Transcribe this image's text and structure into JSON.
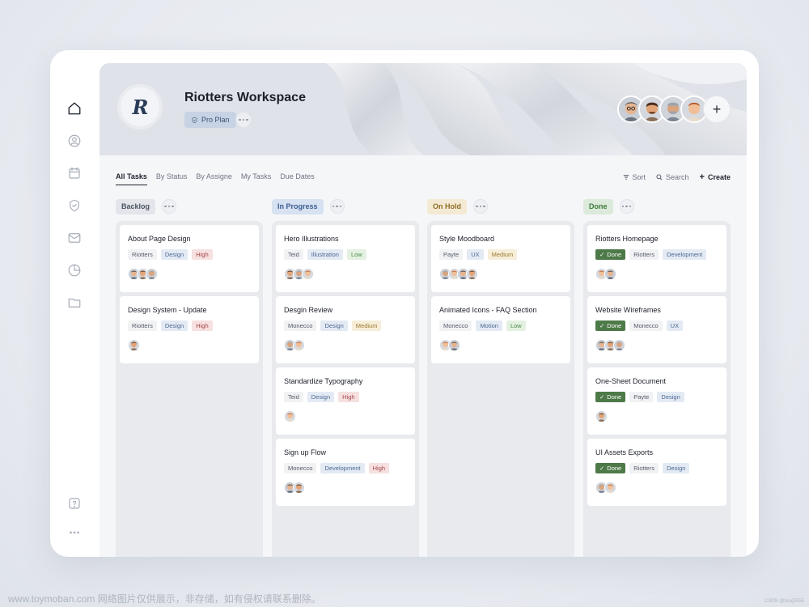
{
  "workspace": {
    "logo_letter": "R",
    "title": "Riotters Workspace",
    "plan": "Pro Plan"
  },
  "sidebar": {
    "items": [
      {
        "icon": "home-icon",
        "active": true
      },
      {
        "icon": "user-circle-icon",
        "active": false
      },
      {
        "icon": "calendar-icon",
        "active": false
      },
      {
        "icon": "shield-icon",
        "active": false
      },
      {
        "icon": "mail-icon",
        "active": false
      },
      {
        "icon": "pie-chart-icon",
        "active": false
      },
      {
        "icon": "folder-icon",
        "active": false
      }
    ],
    "help_icon": "help-icon",
    "more_icon": "more-icon"
  },
  "members": [
    "avatar-1",
    "avatar-2",
    "avatar-3",
    "avatar-4"
  ],
  "add_member_label": "+",
  "tabs": [
    {
      "label": "All Tasks",
      "active": true
    },
    {
      "label": "By Status",
      "active": false
    },
    {
      "label": "By Assigne",
      "active": false
    },
    {
      "label": "My Tasks",
      "active": false
    },
    {
      "label": "Due Dates",
      "active": false
    }
  ],
  "toolbar": {
    "sort": "Sort",
    "search": "Search",
    "create": "Create",
    "create_symbol": "+"
  },
  "columns": [
    {
      "status": "Backlog",
      "pill_bg": "#e3e5ea",
      "pill_color": "#4c525e",
      "cards": [
        {
          "title": "About Page Design",
          "tags": [
            [
              "Riotters",
              "neutral"
            ],
            [
              "Design",
              "blue"
            ],
            [
              "High",
              "red"
            ]
          ],
          "avatars": 3
        },
        {
          "title": "Design System - Update",
          "tags": [
            [
              "Riotters",
              "neutral"
            ],
            [
              "Design",
              "blue"
            ],
            [
              "High",
              "red"
            ]
          ],
          "avatars": 1
        }
      ]
    },
    {
      "status": "In Progress",
      "pill_bg": "#d6e1f1",
      "pill_color": "#3e5e93",
      "cards": [
        {
          "title": "Hero Illustrations",
          "tags": [
            [
              "Teid",
              "neutral"
            ],
            [
              "Illustration",
              "blue"
            ],
            [
              "Low",
              "green"
            ]
          ],
          "avatars": 3
        },
        {
          "title": "Desgin Review",
          "tags": [
            [
              "Monecco",
              "neutral"
            ],
            [
              "Design",
              "blue"
            ],
            [
              "Medium",
              "yellow"
            ]
          ],
          "avatars": 2
        },
        {
          "title": "Standardize Typography",
          "tags": [
            [
              "Teid",
              "neutral"
            ],
            [
              "Design",
              "blue"
            ],
            [
              "High",
              "red"
            ]
          ],
          "avatars": 1
        },
        {
          "title": "Sign up Flow",
          "tags": [
            [
              "Monecco",
              "neutral"
            ],
            [
              "Development",
              "blue"
            ],
            [
              "High",
              "red"
            ]
          ],
          "avatars": 2
        }
      ]
    },
    {
      "status": "On Hold",
      "pill_bg": "#f4ead4",
      "pill_color": "#8d6d24",
      "cards": [
        {
          "title": "Style Moodboard",
          "tags": [
            [
              "Payte",
              "neutral"
            ],
            [
              "UX",
              "blue"
            ],
            [
              "Medium",
              "yellow"
            ]
          ],
          "avatars": 4
        },
        {
          "title": "Animated Icons - FAQ Section",
          "tags": [
            [
              "Monecco",
              "neutral"
            ],
            [
              "Motion",
              "blue"
            ],
            [
              "Low",
              "green"
            ]
          ],
          "avatars": 2
        }
      ]
    },
    {
      "status": "Done",
      "pill_bg": "#dbeadb",
      "pill_color": "#3f7a3c",
      "cards": [
        {
          "title": "Riotters Homepage",
          "tags": [
            [
              "Done",
              "done"
            ],
            [
              "Riotters",
              "neutral"
            ],
            [
              "Development",
              "blue"
            ]
          ],
          "avatars": 2
        },
        {
          "title": "Website Wireframes",
          "tags": [
            [
              "Done",
              "done"
            ],
            [
              "Monecco",
              "neutral"
            ],
            [
              "UX",
              "blue"
            ]
          ],
          "avatars": 3
        },
        {
          "title": "One-Sheet Document",
          "tags": [
            [
              "Done",
              "done"
            ],
            [
              "Payte",
              "neutral"
            ],
            [
              "Design",
              "blue"
            ]
          ],
          "avatars": 1
        },
        {
          "title": "UI Assets Exports",
          "tags": [
            [
              "Done",
              "done"
            ],
            [
              "Riotters",
              "neutral"
            ],
            [
              "Design",
              "blue"
            ]
          ],
          "avatars": 2
        }
      ]
    }
  ],
  "watermark": "www.toymoban.com 网络图片仅供展示，非存储，如有侵权请联系删除。",
  "credit": "CSDN @bsuj5555"
}
